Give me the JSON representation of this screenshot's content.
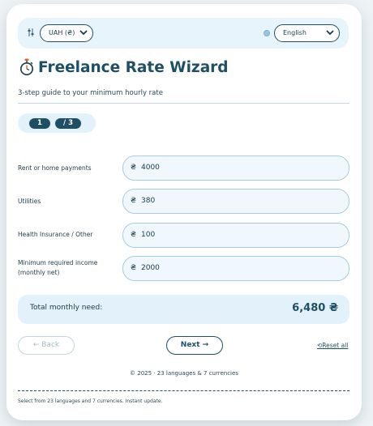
{
  "header": {
    "currency_selected": "UAH (₴)",
    "language_selected": "English"
  },
  "title": "Freelance Rate Wizard",
  "subtitle": "3-step guide to your minimum hourly rate",
  "steps": {
    "current": "1",
    "total": "/ 3"
  },
  "fields": [
    {
      "label": "Rent or home payments",
      "symbol": "₴",
      "value": "4000"
    },
    {
      "label": "Utilities",
      "symbol": "₴",
      "value": "380"
    },
    {
      "label": "Health Insurance / Other",
      "symbol": "₴",
      "value": "100"
    },
    {
      "label": "Minimum required income (monthly net)",
      "symbol": "₴",
      "value": "2000"
    }
  ],
  "total": {
    "label": "Total monthly need:",
    "value": "6,480 ₴"
  },
  "buttons": {
    "back": "← Back",
    "next": "Next →",
    "reset": "Reset all"
  },
  "footer": {
    "info": "© 2025 · 23 languages & 7 currencies",
    "note": "Select from 23 languages and 7 currencies. Instant update."
  },
  "colors": {
    "accent": "#1e4f65",
    "panel": "#e3f1fa",
    "input_bg": "#f0f8fd"
  }
}
